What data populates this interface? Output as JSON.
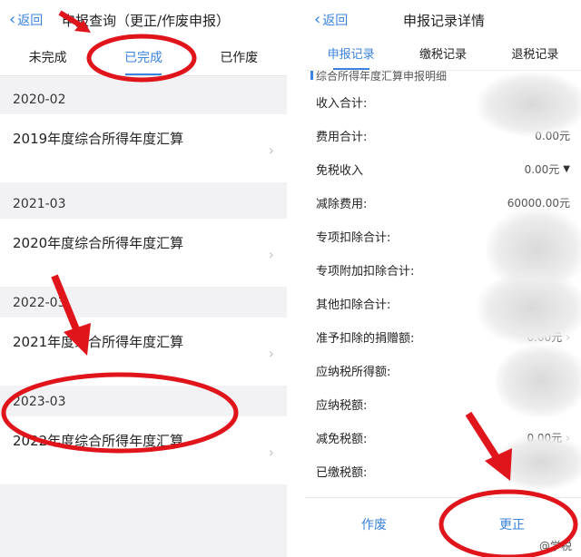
{
  "left": {
    "back_label": "返回",
    "title": "申报查询（更正/作废申报）",
    "tabs": [
      "未完成",
      "已完成",
      "已作废"
    ],
    "active_tab": 1,
    "groups": [
      {
        "period": "2020-02",
        "title": "2019年度综合所得年度汇算"
      },
      {
        "period": "2021-03",
        "title": "2020年度综合所得年度汇算"
      },
      {
        "period": "2022-03",
        "title": "2021年度综合所得年度汇算"
      },
      {
        "period": "2023-03",
        "title": "2022年度综合所得年度汇算"
      }
    ]
  },
  "right": {
    "back_label": "返回",
    "title": "申报记录详情",
    "tabs": [
      "申报记录",
      "缴税记录",
      "退税记录"
    ],
    "active_tab": 0,
    "section_title": "综合所得年度汇算申报明细",
    "rows": [
      {
        "label": "收入合计:",
        "value": ""
      },
      {
        "label": "费用合计:",
        "value": "0.00元"
      },
      {
        "label": "免税收入",
        "value": "0.00元",
        "dropdown": true
      },
      {
        "label": "减除费用:",
        "value": "60000.00元"
      },
      {
        "label": "专项扣除合计:",
        "value": ""
      },
      {
        "label": "专项附加扣除合计:",
        "value": ""
      },
      {
        "label": "其他扣除合计:",
        "value": ""
      },
      {
        "label": "准予扣除的捐赠额:",
        "value": "0.00元",
        "chevron": true
      },
      {
        "label": "应纳税所得额:",
        "value": ""
      },
      {
        "label": "应纳税额:",
        "value": ""
      },
      {
        "label": "减免税额:",
        "value": "0.00元",
        "chevron": true
      },
      {
        "label": "已缴税额:",
        "value": ""
      }
    ],
    "buttons": {
      "void": "作废",
      "correct": "更正"
    },
    "watermark": "@学税"
  },
  "colors": {
    "accent": "#3a83e0",
    "annotation": "#e0141b",
    "page_bg": "#f2f2f4"
  },
  "icons": {
    "back": "chevron-left-icon",
    "row_arrow": "chevron-right-icon",
    "dropdown": "caret-down-icon"
  }
}
